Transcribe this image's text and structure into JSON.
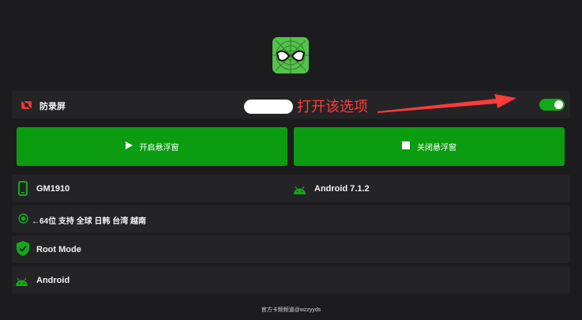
{
  "annotation": {
    "text": "打开该选项",
    "color": "#ff3b3b"
  },
  "settings": {
    "anti_record_label": "防录屏",
    "anti_record_enabled": true
  },
  "buttons": {
    "start_float_label": "开启悬浮窗",
    "stop_float_label": "关闭悬浮窗",
    "color": "#0b9c12"
  },
  "device": {
    "model": "GM1910",
    "android_version": "Android 7.1.2",
    "arch_info": "←64位 支持 全球 日韩 台湾 越南",
    "root_mode": "Root Mode",
    "platform": "Android"
  },
  "footer": {
    "text": "官方卡频频道@wzzyyds"
  },
  "icons": {
    "logo": "spider-mask-icon",
    "record": "no-record-icon",
    "phone": "phone-icon",
    "android": "android-icon",
    "radio": "radio-icon",
    "shield": "shield-check-icon"
  }
}
